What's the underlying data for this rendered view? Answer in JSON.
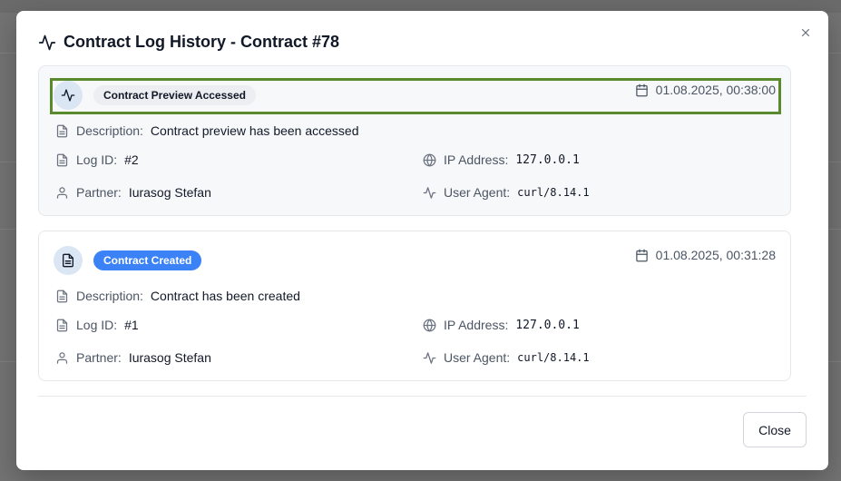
{
  "modal": {
    "title": "Contract Log History - Contract #78",
    "close_button_label": "Close"
  },
  "logs": [
    {
      "badge": "Contract Preview Accessed",
      "badge_style": "neutral",
      "icon": "activity-icon",
      "timestamp": "01.08.2025, 00:38:00",
      "description_label": "Description:",
      "description": "Contract preview has been accessed",
      "log_id_label": "Log ID:",
      "log_id": "#2",
      "partner_label": "Partner:",
      "partner": "Iurasog Stefan",
      "ip_label": "IP Address:",
      "ip": "127.0.0.1",
      "agent_label": "User Agent:",
      "agent": "curl/8.14.1"
    },
    {
      "badge": "Contract Created",
      "badge_style": "primary",
      "icon": "document-icon",
      "timestamp": "01.08.2025, 00:31:28",
      "description_label": "Description:",
      "description": "Contract has been created",
      "log_id_label": "Log ID:",
      "log_id": "#1",
      "partner_label": "Partner:",
      "partner": "Iurasog Stefan",
      "ip_label": "IP Address:",
      "ip": "127.0.0.1",
      "agent_label": "User Agent:",
      "agent": "curl/8.14.1"
    }
  ],
  "colors": {
    "primary_badge": "#3b82f6",
    "selection_outline": "#5a8a2e",
    "icon_circle": "#dbe6f4"
  }
}
